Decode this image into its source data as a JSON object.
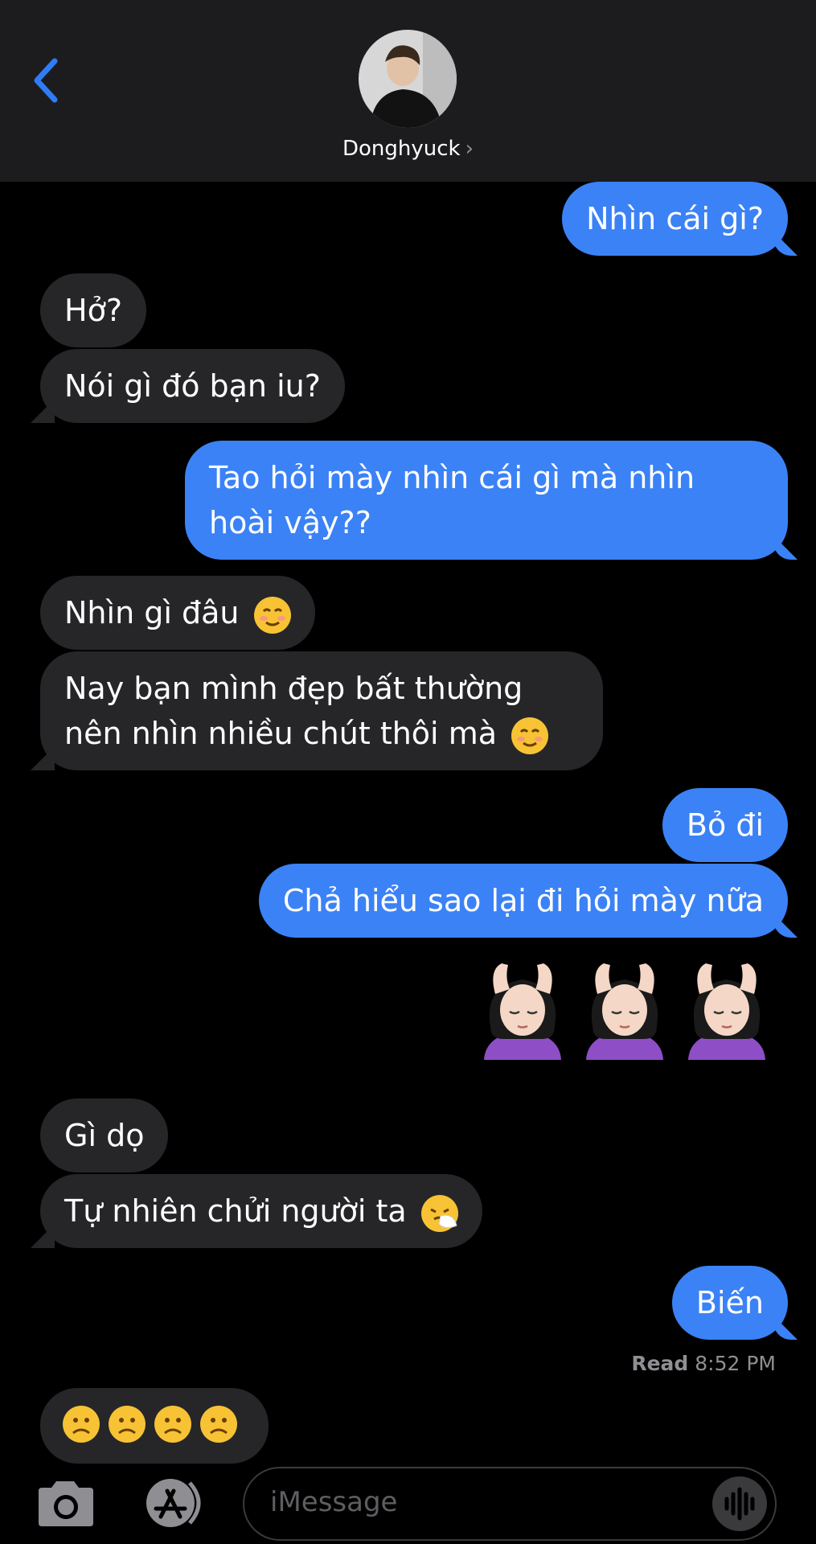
{
  "header": {
    "contact_name": "Donghyuck",
    "name_chevron": "›"
  },
  "messages": [
    {
      "from": "me",
      "text": "Nhìn cái gì?"
    },
    {
      "from": "them",
      "text": "Hở?"
    },
    {
      "from": "them",
      "text": "Nói gì đó bạn iu?"
    },
    {
      "from": "me",
      "text": "Tao hỏi mày nhìn cái gì mà nhìn hoài vậy??"
    },
    {
      "from": "them",
      "text": "Nhìn gì đâu"
    },
    {
      "from": "them",
      "text": "Nay bạn mình đẹp bất thường nên nhìn nhiều chút thôi mà"
    },
    {
      "from": "me",
      "text": "Bỏ đi"
    },
    {
      "from": "me",
      "text": "Chả hiểu sao lại đi hỏi mày nữa"
    },
    {
      "from": "me",
      "emoji": "woman-getting-massage x3"
    },
    {
      "from": "them",
      "text": "Gì dọ"
    },
    {
      "from": "them",
      "text": "Tự nhiên chửi người ta"
    },
    {
      "from": "me",
      "text": "Biến"
    },
    {
      "from": "them",
      "emoji": "frowning-face x4"
    }
  ],
  "read_receipt": {
    "label": "Read",
    "time": "8:52 PM"
  },
  "input": {
    "placeholder": "iMessage"
  },
  "colors": {
    "sent_bubble": "#3b82f6",
    "received_bubble": "#262628",
    "header_bg": "#1c1c1e",
    "accent": "#2f7cf6"
  }
}
